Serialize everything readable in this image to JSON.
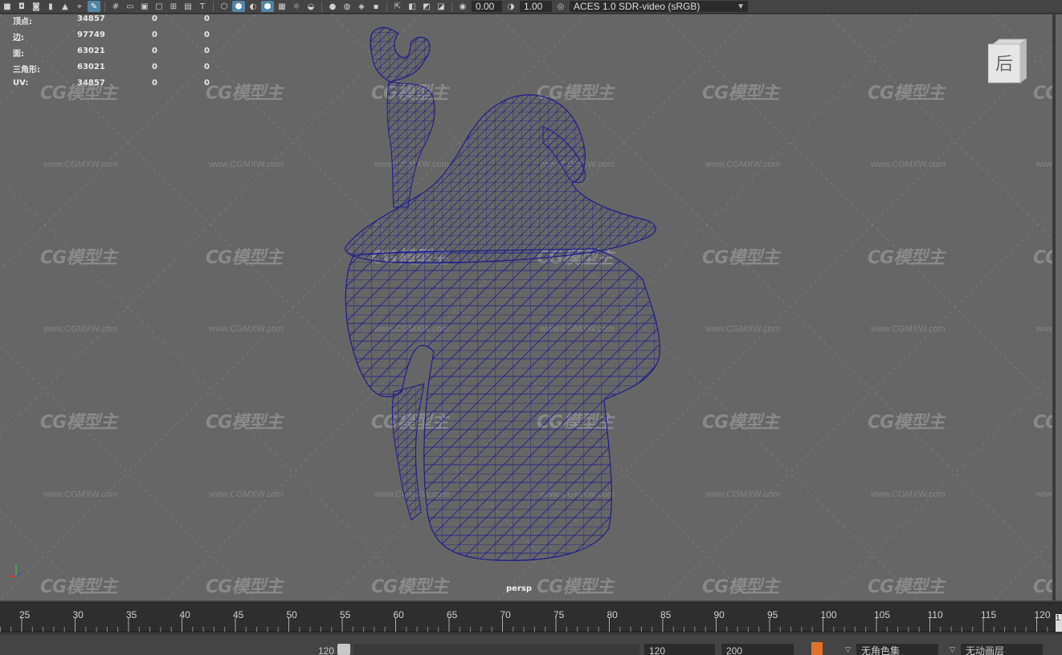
{
  "toolbar": {
    "exposure_value": "0.00",
    "gamma_value": "1.00",
    "color_space": "ACES 1.0 SDR-video (sRGB)"
  },
  "hud": {
    "rows": [
      {
        "label": "顶点:",
        "v1": "34857",
        "v2": "0",
        "v3": "0"
      },
      {
        "label": "边:",
        "v1": "97749",
        "v2": "0",
        "v3": "0"
      },
      {
        "label": "面:",
        "v1": "63021",
        "v2": "0",
        "v3": "0"
      },
      {
        "label": "三角形:",
        "v1": "63021",
        "v2": "0",
        "v3": "0"
      },
      {
        "label": "UV:",
        "v1": "34857",
        "v2": "0",
        "v3": "0"
      }
    ]
  },
  "view_cube": {
    "face_label": "后"
  },
  "camera_label": "persp",
  "watermark": {
    "logo": "CG模型主",
    "url": "www.CGMXW.com"
  },
  "timeline": {
    "ticks": [
      "25",
      "30",
      "35",
      "40",
      "45",
      "50",
      "55",
      "60",
      "65",
      "70",
      "75",
      "80",
      "85",
      "90",
      "95",
      "100",
      "105",
      "110",
      "115",
      "120"
    ],
    "current_frame": "1"
  },
  "range_bar": {
    "slider_end": "120",
    "anim_end": "120",
    "max_end": "200",
    "character_set": "无角色集",
    "anim_layer": "无动画层"
  },
  "colors": {
    "viewport_bg": "#666666",
    "wireframe": "#1c1c8c",
    "active_icon": "#5285a6",
    "key_accent": "#e0702c"
  }
}
